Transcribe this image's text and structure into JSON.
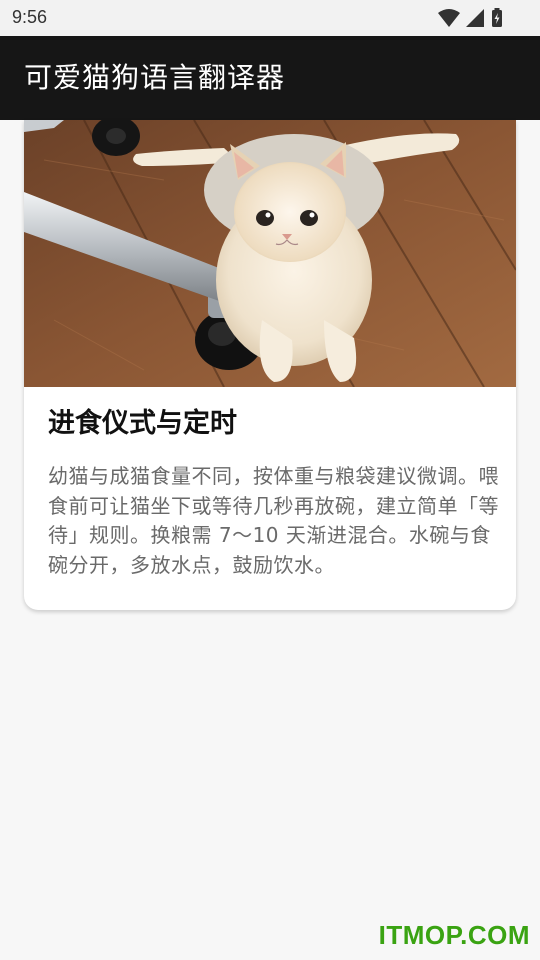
{
  "status_bar": {
    "time": "9:56",
    "icons": [
      "wifi-icon",
      "signal-icon",
      "battery-charging-icon"
    ]
  },
  "app_bar": {
    "title": "可爱猫狗语言翻译器"
  },
  "article_card": {
    "image": "cat-photo",
    "title": "进食仪式与定时",
    "body": "幼猫与成猫食量不同，按体重与粮袋建议微调。喂食前可让猫坐下或等待几秒再放碗，建立简单「等待」规则。换粮需 7～10 天渐进混合。水碗与食碗分开，多放水点，鼓励饮水。"
  },
  "watermark": {
    "text": "ITMOP.COM",
    "color": "#3aa312"
  },
  "colors": {
    "app_bar_background": "#161616",
    "status_bar_background": "#f2f2f2",
    "page_background": "#f7f7f7"
  }
}
